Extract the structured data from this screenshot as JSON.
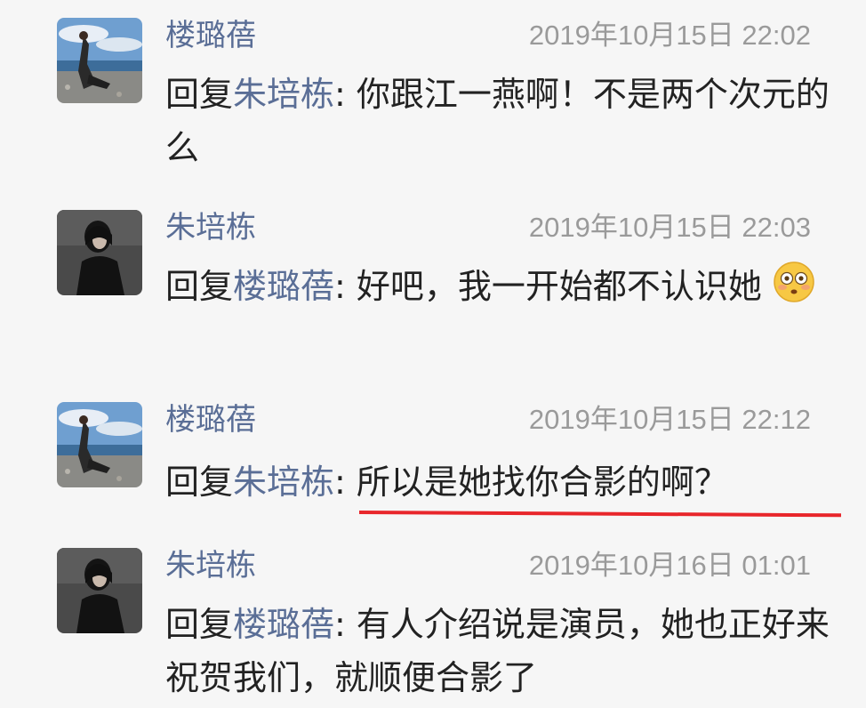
{
  "comments": [
    {
      "author": "楼璐蓓",
      "time": "2019年10月15日 22:02",
      "reply_prefix": "回复",
      "reply_target": "朱培栋",
      "separator": ": ",
      "text": "你跟江一燕啊！不是两个次元的么",
      "avatar": "landscape-photo-avatar"
    },
    {
      "author": "朱培栋",
      "time": "2019年10月15日 22:03",
      "reply_prefix": "回复",
      "reply_target": "楼璐蓓",
      "separator": ": ",
      "text": "好吧，我一开始都不认识她",
      "emoji": "flushed-face-emoji",
      "avatar": "dark-portrait-avatar"
    },
    {
      "author": "楼璐蓓",
      "time": "2019年10月15日 22:12",
      "reply_prefix": "回复",
      "reply_target": "朱培栋",
      "separator": ": ",
      "text": "所以是她找你合影的啊？",
      "avatar": "landscape-photo-avatar",
      "highlight_color": "#e8262b"
    },
    {
      "author": "朱培栋",
      "time": "2019年10月16日 01:01",
      "reply_prefix": "回复",
      "reply_target": "楼璐蓓",
      "separator": ": ",
      "text": "有人介绍说是演员，她也正好来祝贺我们，就顺便合影了",
      "avatar": "dark-portrait-avatar"
    }
  ],
  "colors": {
    "name": "#5a6e96",
    "time": "#9a9a9a",
    "text": "#222222",
    "background": "#f6f6f6",
    "underline": "#e8262b"
  }
}
